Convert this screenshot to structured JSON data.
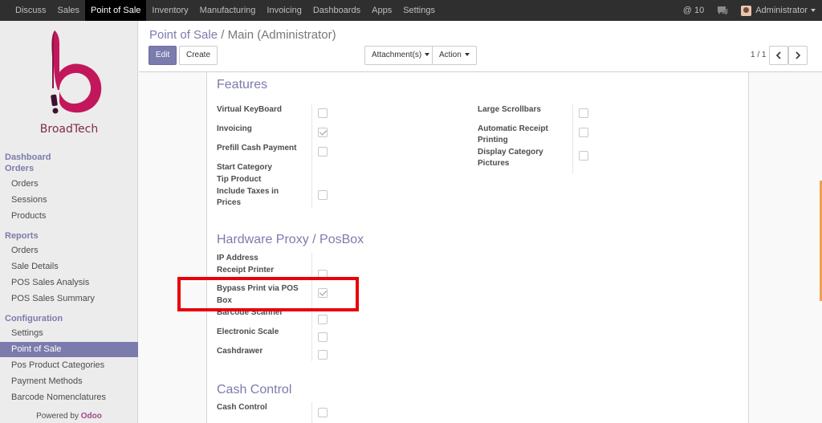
{
  "topbar": {
    "menu": [
      "Discuss",
      "Sales",
      "Point of Sale",
      "Inventory",
      "Manufacturing",
      "Invoicing",
      "Dashboards",
      "Apps",
      "Settings"
    ],
    "active_index": 2,
    "mentions": "@ 10",
    "user": "Administrator"
  },
  "sidebar": {
    "logo_text": "BroadTech",
    "dashboard": "Dashboard",
    "orders_header": "Orders",
    "orders_items": [
      "Orders",
      "Sessions",
      "Products"
    ],
    "reports_header": "Reports",
    "reports_items": [
      "Orders",
      "Sale Details",
      "POS Sales Analysis",
      "POS Sales Summary"
    ],
    "config_header": "Configuration",
    "config_items": [
      "Settings",
      "Point of Sale",
      "Pos Product Categories",
      "Payment Methods",
      "Barcode Nomenclatures"
    ],
    "active_config": "Point of Sale",
    "powered_prefix": "Powered by",
    "powered_brand": "Odoo"
  },
  "control_panel": {
    "breadcrumb_parent": "Point of Sale",
    "breadcrumb_sep": "/",
    "breadcrumb_current": "Main (Administrator)",
    "edit_label": "Edit",
    "create_label": "Create",
    "attachments_label": "Attachment(s)",
    "action_label": "Action",
    "pager": "1 / 1"
  },
  "form": {
    "features_title": "Features",
    "virtual_keyboard": "Virtual KeyBoard",
    "invoicing": "Invoicing",
    "prefill_cash": "Prefill Cash Payment",
    "start_category": "Start Category",
    "tip_product": "Tip Product",
    "include_taxes_1": "Include Taxes in",
    "include_taxes_2": "Prices",
    "large_scrollbars": "Large Scrollbars",
    "auto_receipt_1": "Automatic Receipt",
    "auto_receipt_2": "Printing",
    "display_cat_1": "Display Category",
    "display_cat_2": "Pictures",
    "hardware_title": "Hardware Proxy / PosBox",
    "ip_address": "IP Address",
    "receipt_printer": "Receipt Printer",
    "bypass_1": "Bypass Print via POS",
    "bypass_2": "Box",
    "barcode_scanner": "Barcode Scanner",
    "electronic_scale": "Electronic Scale",
    "cashdrawer": "Cashdrawer",
    "cash_control_title": "Cash Control",
    "cash_control": "Cash Control"
  },
  "colors": {
    "accent": "#7c7bad",
    "highlight": "#e8000b",
    "topbar": "#2f2f2f"
  }
}
